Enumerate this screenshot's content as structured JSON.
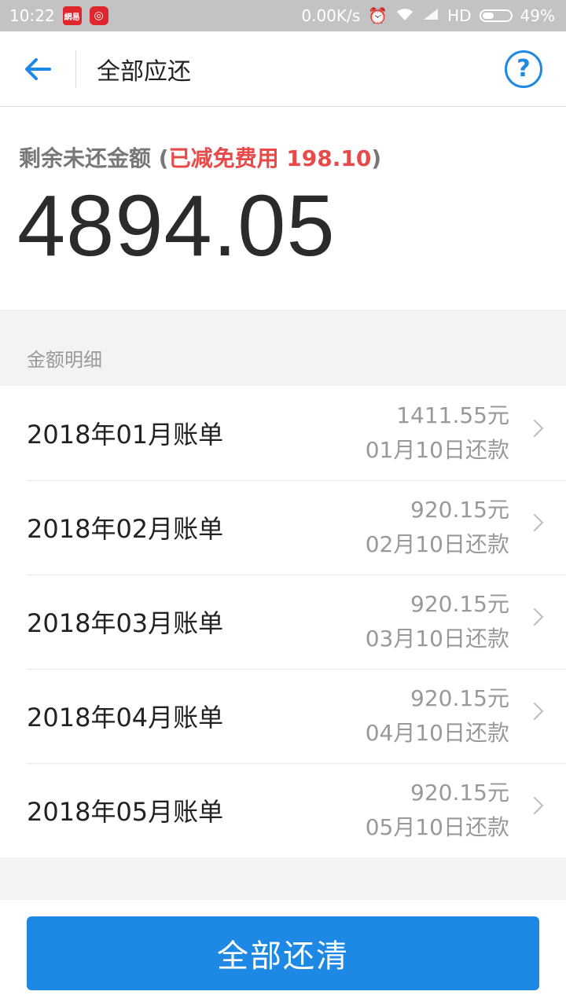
{
  "status_bar": {
    "time": "10:22",
    "net_speed": "0.00K/s",
    "network": "HD",
    "battery": "49%",
    "app_icons": [
      "netease-news-icon",
      "netease-music-icon"
    ]
  },
  "header": {
    "title": "全部应还",
    "help_symbol": "?"
  },
  "summary": {
    "label": "剩余未还金额",
    "discount_open": "(",
    "discount_text": "已减免费用 198.10",
    "discount_close": ")",
    "amount": "4894.05"
  },
  "details": {
    "section_label": "金额明细",
    "bills": [
      {
        "name": "2018年01月账单",
        "amount": "1411.55元",
        "due": "01月10日还款"
      },
      {
        "name": "2018年02月账单",
        "amount": "920.15元",
        "due": "02月10日还款"
      },
      {
        "name": "2018年03月账单",
        "amount": "920.15元",
        "due": "03月10日还款"
      },
      {
        "name": "2018年04月账单",
        "amount": "920.15元",
        "due": "04月10日还款"
      },
      {
        "name": "2018年05月账单",
        "amount": "920.15元",
        "due": "05月10日还款"
      }
    ]
  },
  "actions": {
    "pay_all_label": "全部还清"
  },
  "colors": {
    "accent": "#1e88e5",
    "discount_red": "#e84a4a"
  }
}
